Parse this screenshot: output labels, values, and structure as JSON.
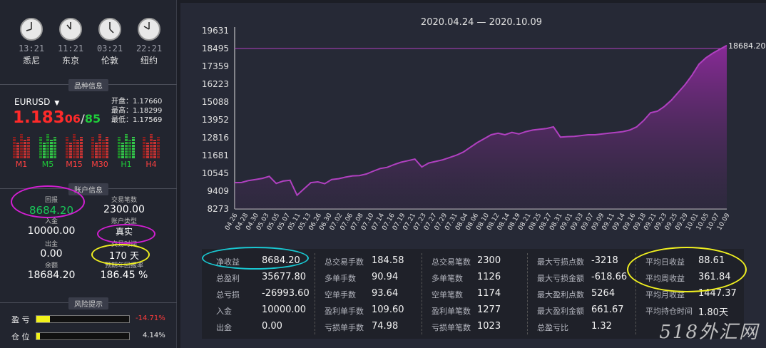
{
  "clocks": [
    {
      "time": "13:21",
      "city": "悉尼"
    },
    {
      "time": "11:21",
      "city": "东京"
    },
    {
      "time": "03:21",
      "city": "伦敦"
    },
    {
      "time": "22:21",
      "city": "纽约"
    }
  ],
  "sections": {
    "symbol_info": "品种信息",
    "account_info": "账户信息",
    "risk": "风险提示"
  },
  "symbol": {
    "pair": "EURUSD",
    "price_big": "1.183",
    "price_mid": "06",
    "price_slash": "/",
    "price_green": "85",
    "open": "开盘：1.17660",
    "high": "最高：1.18299",
    "low": "最低：1.17569"
  },
  "timeframes": [
    "M1",
    "M5",
    "M15",
    "M30",
    "H1",
    "H4"
  ],
  "account": {
    "drawdown_label": "回报",
    "drawdown_value": "8684.20",
    "trades_label": "交易笔数",
    "trades_value": "2300.00",
    "deposit_label": "入金",
    "deposit_value": "10000.00",
    "type_label": "账户类型",
    "type_value": "真实",
    "withdraw_label": "出金",
    "withdraw_value": "0.00",
    "days_label": "交易时间",
    "days_value": "170 天",
    "balance_label": "余额",
    "balance_value": "18684.20",
    "annual_label": "预期年回报率",
    "annual_value": "186.45 %"
  },
  "risk": {
    "pnl_label": "盈 亏",
    "pnl_value": "-14.71%",
    "pnl_fraction": 0.147,
    "position_label": "仓 位",
    "position_value": "4.14%",
    "position_fraction": 0.041
  },
  "chart_data": {
    "type": "area",
    "title": "2020.04.24 — 2020.10.09",
    "yticks": [
      "19631",
      "18495",
      "17359",
      "16223",
      "15088",
      "13952",
      "12816",
      "11681",
      "10545",
      "9409",
      "8273"
    ],
    "ylim": [
      8273,
      19631
    ],
    "xticks": [
      "04.26",
      "04.28",
      "04.30",
      "05.03",
      "05.05",
      "05.07",
      "05.11",
      "05.13",
      "06.26",
      "06.30",
      "07.02",
      "07.06",
      "07.08",
      "07.10",
      "07.14",
      "07.16",
      "07.19",
      "07.21",
      "07.23",
      "07.27",
      "07.29",
      "07.31",
      "08.04",
      "08.06",
      "08.10",
      "08.12",
      "08.14",
      "08.19",
      "08.21",
      "08.25",
      "08.27",
      "08.31",
      "09.01",
      "09.03",
      "09.07",
      "09.09",
      "09.11",
      "09.14",
      "09.16",
      "09.18",
      "09.21",
      "09.23",
      "09.25",
      "09.29",
      "10.01",
      "10.05",
      "10.07",
      "10.09"
    ],
    "last_label": "18684.20",
    "values": [
      9950,
      9960,
      10080,
      10150,
      10220,
      10350,
      9900,
      10050,
      10100,
      9150,
      9550,
      9950,
      10000,
      9880,
      10150,
      10200,
      10300,
      10380,
      10400,
      10500,
      10680,
      10850,
      10920,
      11100,
      11250,
      11350,
      11450,
      10950,
      11200,
      11300,
      11400,
      11550,
      11700,
      11900,
      12200,
      12500,
      12750,
      13000,
      13100,
      13000,
      13150,
      13050,
      13200,
      13300,
      13350,
      13400,
      13500,
      12850,
      12880,
      12900,
      12950,
      13000,
      13000,
      13050,
      13100,
      13150,
      13200,
      13300,
      13500,
      13900,
      14400,
      14500,
      14800,
      15200,
      15700,
      16200,
      16800,
      17500,
      17900,
      18200,
      18450,
      18684.2
    ],
    "reference_line": 18495,
    "color": "#b040c0"
  },
  "stats": {
    "col1": [
      {
        "k": "净收益",
        "v": "8684.20"
      },
      {
        "k": "总盈利",
        "v": "35677.80"
      },
      {
        "k": "总亏损",
        "v": "-26993.60"
      },
      {
        "k": "入金",
        "v": "10000.00"
      },
      {
        "k": "出金",
        "v": "0.00"
      }
    ],
    "col2": [
      {
        "k": "总交易手数",
        "v": "184.58"
      },
      {
        "k": "多单手数",
        "v": "90.94"
      },
      {
        "k": "空单手数",
        "v": "93.64"
      },
      {
        "k": "盈利单手数",
        "v": "109.60"
      },
      {
        "k": "亏损单手数",
        "v": "74.98"
      }
    ],
    "col3": [
      {
        "k": "总交易笔数",
        "v": "2300"
      },
      {
        "k": "多单笔数",
        "v": "1126"
      },
      {
        "k": "空单笔数",
        "v": "1174"
      },
      {
        "k": "盈利单笔数",
        "v": "1277"
      },
      {
        "k": "亏损单笔数",
        "v": "1023"
      }
    ],
    "col4": [
      {
        "k": "最大亏损点数",
        "v": "-3218"
      },
      {
        "k": "最大亏损金额",
        "v": "-618.66"
      },
      {
        "k": "最大盈利点数",
        "v": "5264"
      },
      {
        "k": "最大盈利金额",
        "v": "661.67"
      },
      {
        "k": "总盈亏比",
        "v": "1.32"
      }
    ],
    "col5": [
      {
        "k": "平均日收益",
        "v": "88.61"
      },
      {
        "k": "平均周收益",
        "v": "361.84"
      },
      {
        "k": "平均月收益",
        "v": "1447.37"
      },
      {
        "k": "平均持仓时间",
        "v": "1.80天"
      }
    ]
  },
  "watermark": "518外汇网",
  "colors": {
    "annotation_magenta": "#d21fd2",
    "annotation_yellow": "#f0f020",
    "annotation_cyan": "#19c8d2",
    "price_red": "#ff2a2a",
    "price_green": "#1fcc3a"
  }
}
